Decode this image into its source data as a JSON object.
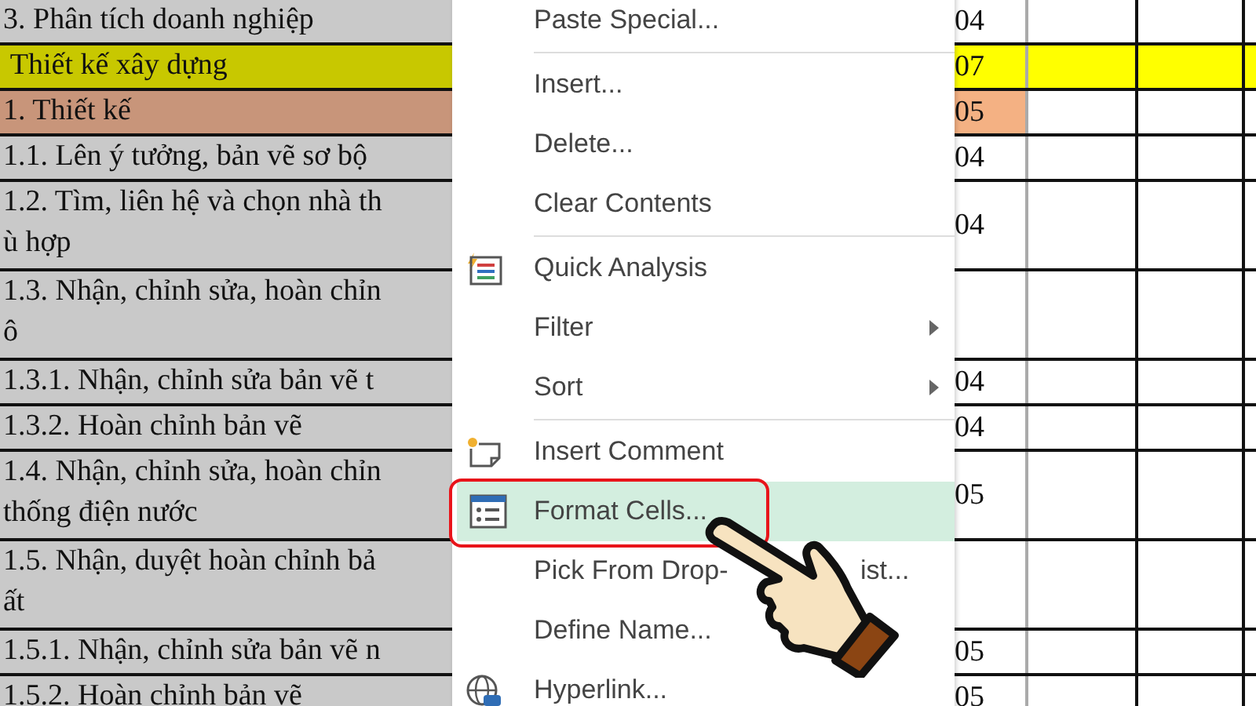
{
  "sheet": {
    "rows": [
      {
        "text": "3. Phân tích doanh nghiệp",
        "value": "04",
        "kind": "plain"
      },
      {
        "text": " Thiết kế xây dựng",
        "value": "07",
        "kind": "section"
      },
      {
        "text": "1. Thiết kế",
        "value": "05",
        "kind": "group"
      },
      {
        "text": "1.1. Lên ý tưởng, bản vẽ sơ bộ",
        "value": "04",
        "kind": "plain"
      },
      {
        "text": "1.2. Tìm, liên hệ và chọn nhà th\nù hợp",
        "value": "04",
        "kind": "plain"
      },
      {
        "text": "1.3. Nhận, chỉnh sửa, hoàn chỉn\nô",
        "kind": "plain"
      },
      {
        "text": "1.3.1. Nhận, chỉnh sửa bản vẽ t",
        "value": "04",
        "kind": "plain"
      },
      {
        "text": "1.3.2. Hoàn chỉnh bản vẽ",
        "value": "04",
        "kind": "plain"
      },
      {
        "text": "1.4. Nhận, chỉnh sửa, hoàn chỉn\nthống điện nước",
        "value": "05",
        "kind": "plain"
      },
      {
        "text": "1.5. Nhận, duyệt hoàn chỉnh bả\nất",
        "kind": "plain"
      },
      {
        "text": "1.5.1. Nhận, chỉnh sửa bản vẽ n",
        "value": "05",
        "kind": "plain"
      },
      {
        "text": "1.5.2. Hoàn chỉnh bản vẽ",
        "value": "05",
        "kind": "plain"
      }
    ]
  },
  "context_menu": {
    "groups": [
      [
        {
          "label": "Paste Special...",
          "kind": "plain",
          "submenu": false,
          "selected": false,
          "annotated": false
        }
      ],
      [
        {
          "label": "Insert...",
          "kind": "plain",
          "submenu": false,
          "selected": false,
          "annotated": false
        },
        {
          "label": "Delete...",
          "kind": "plain",
          "submenu": false,
          "selected": false,
          "annotated": false
        },
        {
          "label": "Clear Contents",
          "kind": "plain",
          "submenu": false,
          "selected": false,
          "annotated": false
        }
      ],
      [
        {
          "label": "Quick Analysis",
          "kind": "analysis",
          "submenu": false,
          "selected": false,
          "annotated": false
        },
        {
          "label": "Filter",
          "kind": "plain",
          "submenu": true,
          "selected": false,
          "annotated": false
        },
        {
          "label": "Sort",
          "kind": "plain",
          "submenu": true,
          "selected": false,
          "annotated": false
        }
      ],
      [
        {
          "label": "Insert Comment",
          "kind": "comment",
          "submenu": false,
          "selected": false,
          "annotated": false
        },
        {
          "label": "Format Cells...",
          "kind": "format",
          "submenu": false,
          "selected": true,
          "annotated": true
        },
        {
          "label": "Pick From Drop-",
          "label_end": "ist...",
          "kind": "plain",
          "submenu": false,
          "selected": false,
          "annotated": false
        },
        {
          "label": "Define Name...",
          "kind": "plain",
          "submenu": false,
          "selected": false,
          "annotated": false
        },
        {
          "label": "Hyperlink...",
          "kind": "link",
          "submenu": false,
          "selected": false,
          "annotated": false
        }
      ]
    ]
  }
}
